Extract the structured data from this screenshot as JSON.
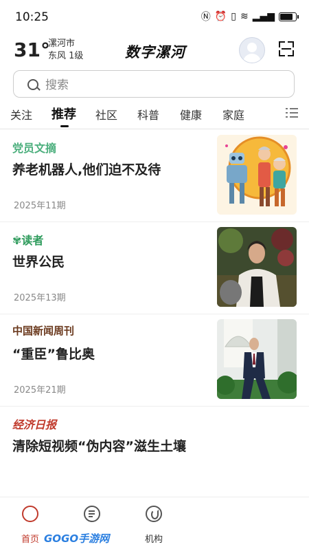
{
  "status_bar": {
    "time": "10:25"
  },
  "header": {
    "temperature": "31°",
    "city": "漯河市",
    "wind": "东风  1级",
    "app_title": "数字漯河"
  },
  "search": {
    "placeholder": "搜索"
  },
  "tabs": [
    {
      "label": "关注",
      "active": false
    },
    {
      "label": "推荐",
      "active": true
    },
    {
      "label": "社区",
      "active": false
    },
    {
      "label": "科普",
      "active": false
    },
    {
      "label": "健康",
      "active": false
    },
    {
      "label": "家庭",
      "active": false
    }
  ],
  "articles": [
    {
      "source": "党员文摘",
      "source_color": "#4caf7d",
      "title": "养老机器人,他们迫不及待",
      "date": "2025年11期"
    },
    {
      "source": "读者",
      "source_color": "#2e9b5c",
      "title": "世界公民",
      "date": "2025年13期"
    },
    {
      "source": "中国新闻周刊",
      "source_color": "#6b3a1e",
      "title": "“重臣”鲁比奥",
      "date": "2025年21期"
    },
    {
      "source": "经济日报",
      "source_color": "#c0392b",
      "title": "清除短视频“伪内容”滋生土壤",
      "date": ""
    }
  ],
  "bottom_nav": [
    {
      "label": "首页",
      "icon": "home-icon",
      "active": true,
      "color": "#c0392b"
    },
    {
      "label": "",
      "icon": "list-icon",
      "active": false
    },
    {
      "label": "机构",
      "icon": "organization-icon",
      "active": false
    }
  ],
  "watermark": "GOGO手游网"
}
